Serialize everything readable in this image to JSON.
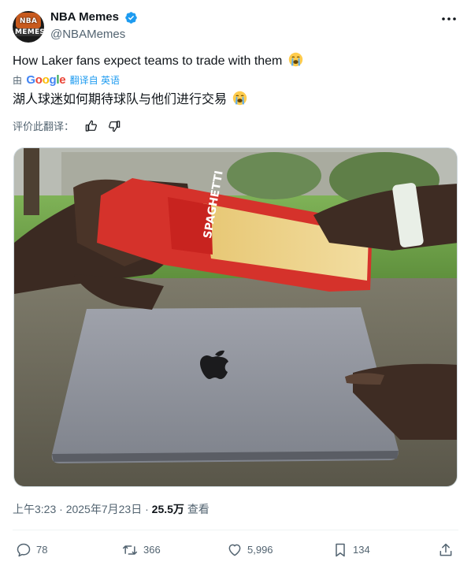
{
  "author": {
    "display_name": "NBA Memes",
    "handle": "@NBAMemes",
    "avatar_text_top": "NBA",
    "avatar_text_bottom": "MEMES"
  },
  "tweet": {
    "text": "How Laker fans expect teams to trade with them",
    "emoji": "loudly-crying-face"
  },
  "translation": {
    "prefix": "由",
    "provider": "Google",
    "action_label": "翻译自 英语",
    "text": "湖人球迷如何期待球队与他们进行交易"
  },
  "rating": {
    "label": "评价此翻译："
  },
  "meta": {
    "time": "上午3:23",
    "separator": " · ",
    "date": "2025年7月23日",
    "views": "25.5万",
    "views_label": "查看"
  },
  "actions": {
    "replies": "78",
    "retweets": "366",
    "likes": "5,996",
    "bookmarks": "134"
  },
  "colors": {
    "text": "#0f1419",
    "secondary": "#536471",
    "link": "#1d9bf0",
    "verified": "#1d9bf0"
  }
}
